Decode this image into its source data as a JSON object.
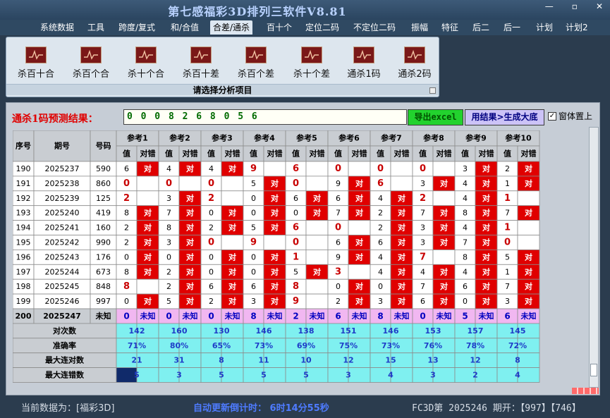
{
  "app": {
    "title": "第七感福彩3D排列三软件V8.81",
    "window_buttons": [
      "—",
      "▫",
      "✕"
    ]
  },
  "menu": [
    "系统数据",
    "工具",
    "跨度/复式",
    "和/合值",
    "合差/通杀",
    "百十个",
    "定位二码",
    "不定位二码",
    "振幅",
    "特征",
    "后二",
    "后一",
    "计划",
    "计划2"
  ],
  "menu_active": "合差/通杀",
  "ribbon": {
    "items": [
      "杀百十合",
      "杀百个合",
      "杀十个合",
      "杀百十差",
      "杀百个差",
      "杀十个差",
      "通杀1码",
      "通杀2码"
    ],
    "caption": "请选择分析项目"
  },
  "prediction": {
    "label": "通杀1码预测结果：",
    "value": "0 0 0 8 2 6 8 0 5 6",
    "export_label": "导出excel",
    "generate_label": "用结果>生成大底",
    "topmost_label": "窗体置上",
    "topmost_checked": true
  },
  "table": {
    "col_headers": [
      "序号",
      "期号",
      "号码"
    ],
    "ref_headers": [
      "参考1",
      "参考2",
      "参考3",
      "参考4",
      "参考5",
      "参考6",
      "参考7",
      "参考8",
      "参考9",
      "参考10"
    ],
    "sub_headers": [
      "值",
      "对错"
    ],
    "rows": [
      {
        "seq": "190",
        "issue": "2025237",
        "num": "590",
        "vals": [
          "6",
          "4",
          "4",
          "9",
          "6",
          "0",
          "0",
          "0",
          "3",
          "2"
        ],
        "marks": [
          "对",
          "对",
          "对",
          "",
          "",
          "",
          "",
          "",
          "对",
          "对"
        ]
      },
      {
        "seq": "191",
        "issue": "2025238",
        "num": "860",
        "vals": [
          "0",
          "0",
          "0",
          "5",
          "0",
          "9",
          "6",
          "3",
          "4",
          "1"
        ],
        "marks": [
          "",
          "",
          "",
          "对",
          "",
          "对",
          "",
          "对",
          "对",
          "对"
        ]
      },
      {
        "seq": "192",
        "issue": "2025239",
        "num": "125",
        "vals": [
          "2",
          "3",
          "2",
          "0",
          "6",
          "6",
          "4",
          "2",
          "4",
          "1"
        ],
        "marks": [
          "",
          "对",
          "",
          "对",
          "对",
          "对",
          "对",
          "",
          "对",
          ""
        ]
      },
      {
        "seq": "193",
        "issue": "2025240",
        "num": "419",
        "vals": [
          "8",
          "7",
          "0",
          "0",
          "0",
          "7",
          "2",
          "7",
          "8",
          "7"
        ],
        "marks": [
          "对",
          "对",
          "对",
          "对",
          "对",
          "对",
          "对",
          "对",
          "对",
          "对"
        ]
      },
      {
        "seq": "194",
        "issue": "2025241",
        "num": "160",
        "vals": [
          "2",
          "8",
          "2",
          "5",
          "6",
          "0",
          "2",
          "3",
          "4",
          "1"
        ],
        "marks": [
          "对",
          "对",
          "对",
          "对",
          "",
          "",
          "对",
          "对",
          "对",
          ""
        ]
      },
      {
        "seq": "195",
        "issue": "2025242",
        "num": "990",
        "vals": [
          "2",
          "3",
          "0",
          "9",
          "0",
          "6",
          "6",
          "3",
          "7",
          "0"
        ],
        "marks": [
          "对",
          "对",
          "",
          "",
          "",
          "对",
          "对",
          "对",
          "对",
          ""
        ]
      },
      {
        "seq": "196",
        "issue": "2025243",
        "num": "176",
        "vals": [
          "0",
          "0",
          "0",
          "0",
          "1",
          "9",
          "4",
          "7",
          "8",
          "5"
        ],
        "marks": [
          "对",
          "对",
          "对",
          "对",
          "",
          "对",
          "对",
          "",
          "对",
          "对"
        ]
      },
      {
        "seq": "197",
        "issue": "2025244",
        "num": "673",
        "vals": [
          "8",
          "2",
          "0",
          "0",
          "5",
          "3",
          "4",
          "4",
          "4",
          "1"
        ],
        "marks": [
          "对",
          "对",
          "对",
          "对",
          "对",
          "",
          "对",
          "对",
          "对",
          "对"
        ]
      },
      {
        "seq": "198",
        "issue": "2025245",
        "num": "848",
        "vals": [
          "8",
          "2",
          "6",
          "6",
          "8",
          "0",
          "0",
          "7",
          "6",
          "7"
        ],
        "marks": [
          "",
          "对",
          "对",
          "对",
          "",
          "对",
          "对",
          "对",
          "对",
          "对"
        ]
      },
      {
        "seq": "199",
        "issue": "2025246",
        "num": "997",
        "vals": [
          "0",
          "5",
          "2",
          "3",
          "9",
          "2",
          "3",
          "6",
          "0",
          "3"
        ],
        "marks": [
          "对",
          "对",
          "对",
          "对",
          "",
          "对",
          "对",
          "对",
          "对",
          "对"
        ]
      }
    ],
    "pending_row": {
      "seq": "200",
      "issue": "2025247",
      "num": "未知",
      "vals": [
        "0",
        "0",
        "0",
        "8",
        "2",
        "6",
        "8",
        "0",
        "5",
        "6"
      ],
      "mark": "未知"
    },
    "stats": [
      {
        "label": "对次数",
        "values": [
          "142",
          "160",
          "130",
          "146",
          "138",
          "151",
          "146",
          "153",
          "157",
          "145"
        ]
      },
      {
        "label": "准确率",
        "values": [
          "71%",
          "80%",
          "65%",
          "73%",
          "69%",
          "75%",
          "73%",
          "76%",
          "78%",
          "72%"
        ]
      },
      {
        "label": "最大连对数",
        "values": [
          "21",
          "31",
          "8",
          "11",
          "10",
          "12",
          "15",
          "13",
          "12",
          "8"
        ]
      },
      {
        "label": "最大连错数",
        "values": [
          "5",
          "3",
          "5",
          "5",
          "5",
          "3",
          "4",
          "3",
          "2",
          "4"
        ]
      }
    ]
  },
  "status": {
    "current_data": "当前数据为：[福彩3D]",
    "countdown": "自动更新倒计时： 6时14分55秒",
    "draw": "FC3D第 2025246 期开：【997】【746】"
  },
  "colors": {
    "correct_mark": "#e00000",
    "pending_row": "#f1b7f1",
    "stats_bg": "#7ff0f0",
    "header_bg": "#c9cdd2",
    "value_red": "#c80000",
    "stats_text": "#1e3cc8",
    "highlight_cell": "#102a6a"
  }
}
